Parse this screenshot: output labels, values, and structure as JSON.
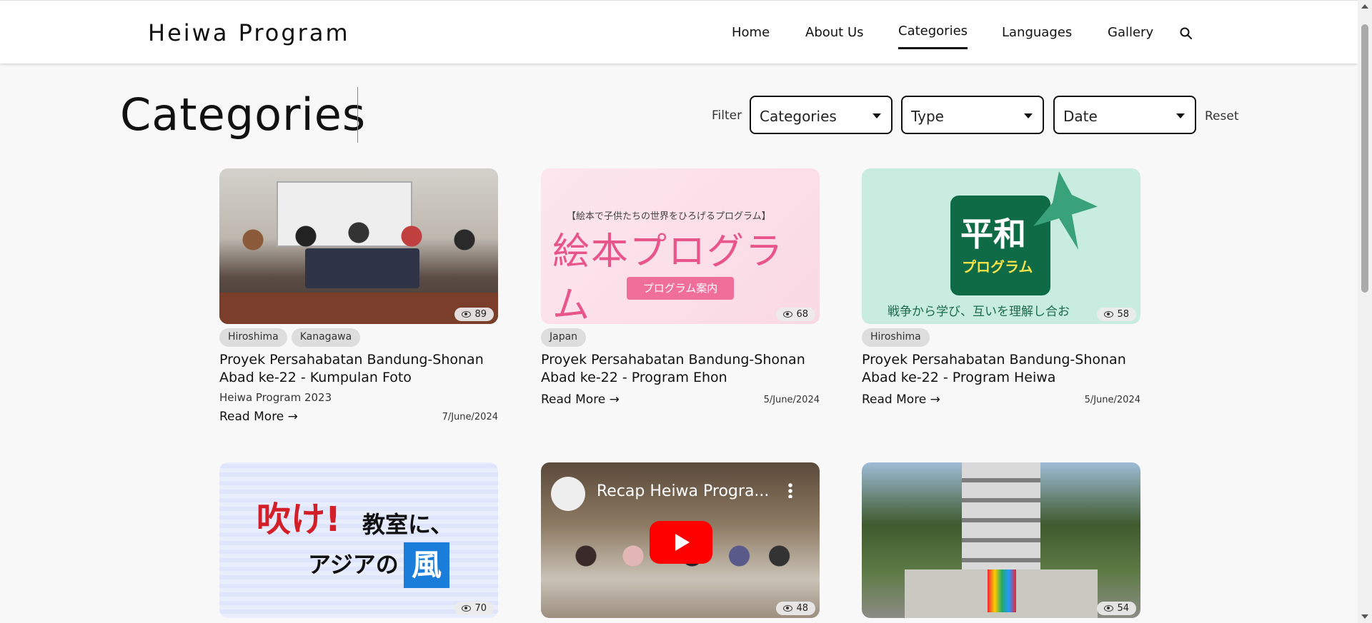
{
  "header": {
    "brand": "Heiwa Program",
    "nav": [
      {
        "label": "Home"
      },
      {
        "label": "About Us"
      },
      {
        "label": "Categories",
        "active": true
      },
      {
        "label": "Languages"
      },
      {
        "label": "Gallery"
      }
    ],
    "search_icon": "search-icon"
  },
  "page": {
    "title": "Categories",
    "filter_label": "Filter",
    "selects": [
      {
        "value": "Categories"
      },
      {
        "value": "Type"
      },
      {
        "value": "Date"
      }
    ],
    "reset_label": "Reset"
  },
  "cards": [
    {
      "views": "89",
      "tags": [
        "Hiroshima",
        "Kanagawa"
      ],
      "title": "Proyek Persahabatan Bandung-Shonan Abad ke-22 - Kumpulan Foto",
      "subtitle": "Heiwa Program 2023",
      "read_more": "Read More →",
      "date": "7/June/2024",
      "thumb_text": []
    },
    {
      "views": "68",
      "tags": [
        "Japan"
      ],
      "title": "Proyek Persahabatan Bandung-Shonan Abad ke-22 - Program Ehon",
      "subtitle": "",
      "read_more": "Read More →",
      "date": "5/June/2024",
      "thumb_text": [
        "【絵本で子供たちの世界をひろげるプログラム】",
        "絵本プログラム",
        "プログラム案内"
      ]
    },
    {
      "views": "58",
      "tags": [
        "Hiroshima"
      ],
      "title": "Proyek Persahabatan Bandung-Shonan Abad ke-22 - Program Heiwa",
      "subtitle": "",
      "read_more": "Read More →",
      "date": "5/June/2024",
      "thumb_text": [
        "平和",
        "プログラム",
        "戦争から学び、互いを理解し合お"
      ]
    },
    {
      "views": "70",
      "thumb_text": [
        "吹け!",
        "教室に、",
        "アジアの",
        "風"
      ]
    },
    {
      "views": "48",
      "thumb_text": [
        "Recap Heiwa Progra..."
      ]
    },
    {
      "views": "54",
      "thumb_text": []
    }
  ],
  "colors": {
    "background": "#f8f8f8",
    "text": "#111111",
    "tag_bg": "#dddddd",
    "youtube_red": "#ff0000"
  }
}
